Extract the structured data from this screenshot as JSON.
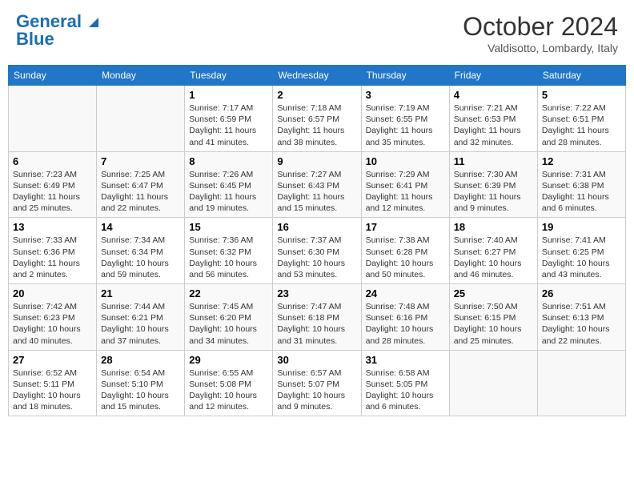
{
  "header": {
    "logo_line1": "General",
    "logo_line2": "Blue",
    "month": "October 2024",
    "location": "Valdisotto, Lombardy, Italy"
  },
  "weekdays": [
    "Sunday",
    "Monday",
    "Tuesday",
    "Wednesday",
    "Thursday",
    "Friday",
    "Saturday"
  ],
  "weeks": [
    [
      {
        "day": "",
        "sunrise": "",
        "sunset": "",
        "daylight": ""
      },
      {
        "day": "",
        "sunrise": "",
        "sunset": "",
        "daylight": ""
      },
      {
        "day": "1",
        "sunrise": "Sunrise: 7:17 AM",
        "sunset": "Sunset: 6:59 PM",
        "daylight": "Daylight: 11 hours and 41 minutes."
      },
      {
        "day": "2",
        "sunrise": "Sunrise: 7:18 AM",
        "sunset": "Sunset: 6:57 PM",
        "daylight": "Daylight: 11 hours and 38 minutes."
      },
      {
        "day": "3",
        "sunrise": "Sunrise: 7:19 AM",
        "sunset": "Sunset: 6:55 PM",
        "daylight": "Daylight: 11 hours and 35 minutes."
      },
      {
        "day": "4",
        "sunrise": "Sunrise: 7:21 AM",
        "sunset": "Sunset: 6:53 PM",
        "daylight": "Daylight: 11 hours and 32 minutes."
      },
      {
        "day": "5",
        "sunrise": "Sunrise: 7:22 AM",
        "sunset": "Sunset: 6:51 PM",
        "daylight": "Daylight: 11 hours and 28 minutes."
      }
    ],
    [
      {
        "day": "6",
        "sunrise": "Sunrise: 7:23 AM",
        "sunset": "Sunset: 6:49 PM",
        "daylight": "Daylight: 11 hours and 25 minutes."
      },
      {
        "day": "7",
        "sunrise": "Sunrise: 7:25 AM",
        "sunset": "Sunset: 6:47 PM",
        "daylight": "Daylight: 11 hours and 22 minutes."
      },
      {
        "day": "8",
        "sunrise": "Sunrise: 7:26 AM",
        "sunset": "Sunset: 6:45 PM",
        "daylight": "Daylight: 11 hours and 19 minutes."
      },
      {
        "day": "9",
        "sunrise": "Sunrise: 7:27 AM",
        "sunset": "Sunset: 6:43 PM",
        "daylight": "Daylight: 11 hours and 15 minutes."
      },
      {
        "day": "10",
        "sunrise": "Sunrise: 7:29 AM",
        "sunset": "Sunset: 6:41 PM",
        "daylight": "Daylight: 11 hours and 12 minutes."
      },
      {
        "day": "11",
        "sunrise": "Sunrise: 7:30 AM",
        "sunset": "Sunset: 6:39 PM",
        "daylight": "Daylight: 11 hours and 9 minutes."
      },
      {
        "day": "12",
        "sunrise": "Sunrise: 7:31 AM",
        "sunset": "Sunset: 6:38 PM",
        "daylight": "Daylight: 11 hours and 6 minutes."
      }
    ],
    [
      {
        "day": "13",
        "sunrise": "Sunrise: 7:33 AM",
        "sunset": "Sunset: 6:36 PM",
        "daylight": "Daylight: 11 hours and 2 minutes."
      },
      {
        "day": "14",
        "sunrise": "Sunrise: 7:34 AM",
        "sunset": "Sunset: 6:34 PM",
        "daylight": "Daylight: 10 hours and 59 minutes."
      },
      {
        "day": "15",
        "sunrise": "Sunrise: 7:36 AM",
        "sunset": "Sunset: 6:32 PM",
        "daylight": "Daylight: 10 hours and 56 minutes."
      },
      {
        "day": "16",
        "sunrise": "Sunrise: 7:37 AM",
        "sunset": "Sunset: 6:30 PM",
        "daylight": "Daylight: 10 hours and 53 minutes."
      },
      {
        "day": "17",
        "sunrise": "Sunrise: 7:38 AM",
        "sunset": "Sunset: 6:28 PM",
        "daylight": "Daylight: 10 hours and 50 minutes."
      },
      {
        "day": "18",
        "sunrise": "Sunrise: 7:40 AM",
        "sunset": "Sunset: 6:27 PM",
        "daylight": "Daylight: 10 hours and 46 minutes."
      },
      {
        "day": "19",
        "sunrise": "Sunrise: 7:41 AM",
        "sunset": "Sunset: 6:25 PM",
        "daylight": "Daylight: 10 hours and 43 minutes."
      }
    ],
    [
      {
        "day": "20",
        "sunrise": "Sunrise: 7:42 AM",
        "sunset": "Sunset: 6:23 PM",
        "daylight": "Daylight: 10 hours and 40 minutes."
      },
      {
        "day": "21",
        "sunrise": "Sunrise: 7:44 AM",
        "sunset": "Sunset: 6:21 PM",
        "daylight": "Daylight: 10 hours and 37 minutes."
      },
      {
        "day": "22",
        "sunrise": "Sunrise: 7:45 AM",
        "sunset": "Sunset: 6:20 PM",
        "daylight": "Daylight: 10 hours and 34 minutes."
      },
      {
        "day": "23",
        "sunrise": "Sunrise: 7:47 AM",
        "sunset": "Sunset: 6:18 PM",
        "daylight": "Daylight: 10 hours and 31 minutes."
      },
      {
        "day": "24",
        "sunrise": "Sunrise: 7:48 AM",
        "sunset": "Sunset: 6:16 PM",
        "daylight": "Daylight: 10 hours and 28 minutes."
      },
      {
        "day": "25",
        "sunrise": "Sunrise: 7:50 AM",
        "sunset": "Sunset: 6:15 PM",
        "daylight": "Daylight: 10 hours and 25 minutes."
      },
      {
        "day": "26",
        "sunrise": "Sunrise: 7:51 AM",
        "sunset": "Sunset: 6:13 PM",
        "daylight": "Daylight: 10 hours and 22 minutes."
      }
    ],
    [
      {
        "day": "27",
        "sunrise": "Sunrise: 6:52 AM",
        "sunset": "Sunset: 5:11 PM",
        "daylight": "Daylight: 10 hours and 18 minutes."
      },
      {
        "day": "28",
        "sunrise": "Sunrise: 6:54 AM",
        "sunset": "Sunset: 5:10 PM",
        "daylight": "Daylight: 10 hours and 15 minutes."
      },
      {
        "day": "29",
        "sunrise": "Sunrise: 6:55 AM",
        "sunset": "Sunset: 5:08 PM",
        "daylight": "Daylight: 10 hours and 12 minutes."
      },
      {
        "day": "30",
        "sunrise": "Sunrise: 6:57 AM",
        "sunset": "Sunset: 5:07 PM",
        "daylight": "Daylight: 10 hours and 9 minutes."
      },
      {
        "day": "31",
        "sunrise": "Sunrise: 6:58 AM",
        "sunset": "Sunset: 5:05 PM",
        "daylight": "Daylight: 10 hours and 6 minutes."
      },
      {
        "day": "",
        "sunrise": "",
        "sunset": "",
        "daylight": ""
      },
      {
        "day": "",
        "sunrise": "",
        "sunset": "",
        "daylight": ""
      }
    ]
  ]
}
